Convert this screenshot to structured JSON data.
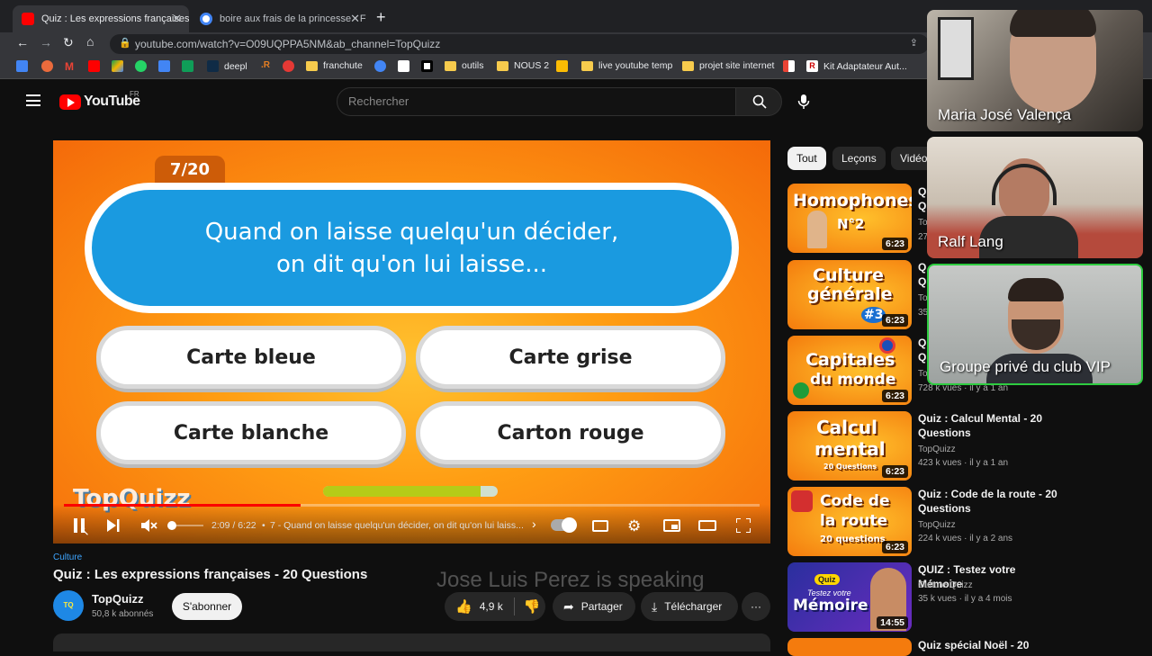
{
  "browser": {
    "tabs": [
      {
        "title": "Quiz : Les expressions françaises",
        "active": true
      },
      {
        "title": "boire aux frais de la princesse - F",
        "active": false
      }
    ],
    "url": "youtube.com/watch?v=O09UQPPA5NM&ab_channel=TopQuizz",
    "bookmarks": [
      "deepl",
      "franchute",
      "outils",
      "NOUS 2",
      "live youtube temp",
      "projet site internet",
      "Kit Adaptateur Aut..."
    ]
  },
  "youtube": {
    "logo": "YouTube",
    "region": "FR",
    "search_placeholder": "Rechercher"
  },
  "video": {
    "counter": "7/20",
    "question_line1": "Quand on laisse quelqu'un décider,",
    "question_line2": "on dit qu'on lui laisse...",
    "answers": [
      "Carte bleue",
      "Carte grise",
      "Carte blanche",
      "Carton rouge"
    ],
    "watermark": "TopQuizz",
    "time": "2:09 / 6:22",
    "chapter": "7 - Quand on laisse quelqu'un décider, on dit qu'on lui laiss...",
    "progress": 0.34
  },
  "meta": {
    "category": "Culture",
    "title": "Quiz : Les expressions françaises - 20 Questions",
    "channel": "TopQuizz",
    "subscribers": "50,8 k abonnés",
    "subscribe": "S'abonner",
    "likes": "4,9 k",
    "share": "Partager",
    "download": "Télécharger",
    "more": "···",
    "speaking": "Jose Luis Perez is speaking"
  },
  "filters": [
    "Tout",
    "Leçons",
    "Vidéo"
  ],
  "recommendations": [
    {
      "thumb": "Homophones N°2",
      "duration": "6:23",
      "title": "Q",
      "title2": "Q",
      "channel": "To",
      "stats": "27"
    },
    {
      "thumb": "Culture générale #3",
      "duration": "6:23",
      "title": "Q",
      "title2": "Q",
      "channel": "To",
      "stats": "35"
    },
    {
      "thumb": "Capitales du monde",
      "duration": "6:23",
      "title": "Q",
      "title2": "Q",
      "channel": "To",
      "stats": "728 k vues · il y a 1 an"
    },
    {
      "thumb": "Calcul mental 20 Questions",
      "duration": "6:23",
      "title": "Quiz : Calcul Mental - 20",
      "title2": "Questions",
      "channel": "TopQuizz",
      "stats": "423 k vues · il y a 1 an"
    },
    {
      "thumb": "Code de la route 20 questions",
      "duration": "6:23",
      "title": "Quiz : Code de la route - 20",
      "title2": "Questions",
      "channel": "TopQuizz",
      "stats": "224 k vues · il y a 2 ans"
    },
    {
      "thumb": "Quiz Testez votre Mémoire",
      "duration": "14:55",
      "title": "QUIZ : Testez votre Mémoire",
      "title2": "",
      "channel": "Culture Quizz",
      "stats": "35 k vues · il y a 4 mois"
    },
    {
      "thumb": "",
      "duration": "",
      "title": "Quiz spécial Noël - 20",
      "title2": "",
      "channel": "",
      "stats": ""
    }
  ],
  "participants": [
    "Maria José Valença",
    "Ralf Lang",
    "Groupe privé du club VIP"
  ]
}
